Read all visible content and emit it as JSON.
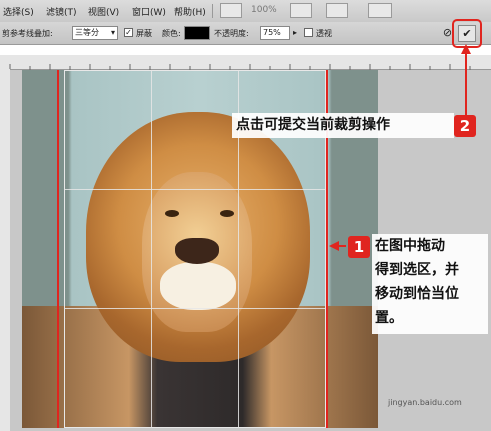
{
  "menubar": {
    "items": [
      "选择(S)",
      "滤镜(T)",
      "视图(V)",
      "窗口(W)",
      "帮助(H)"
    ],
    "zoom": "100%"
  },
  "options": {
    "overlay_label": "剪参考线叠加:",
    "overlay_value": "三等分",
    "shield_label": "屏蔽",
    "color_label": "颜色:",
    "color_value": "#000000",
    "opacity_label": "不透明度:",
    "opacity_value": "75%",
    "perspective_label": "透视"
  },
  "annotations": {
    "step2_number": "2",
    "step2_text": "点击可提交当前裁剪操作",
    "step1_number": "1",
    "step1_lines": [
      "在图中拖动",
      "得到选区，并",
      "移动到恰当位",
      "置。"
    ],
    "accent": "#e0251f"
  },
  "buttons": {
    "confirm_icon": "check-icon",
    "cancel_icon": "cancel-icon",
    "confirm_glyph": "✔",
    "cancel_glyph": "⊘"
  },
  "watermark": "jingyan.baidu.com"
}
